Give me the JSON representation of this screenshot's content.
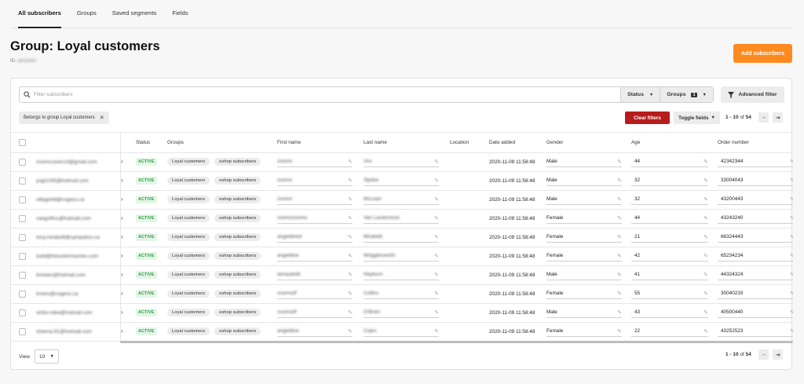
{
  "tabs": [
    {
      "label": "All subscribers",
      "active": true
    },
    {
      "label": "Groups",
      "active": false
    },
    {
      "label": "Saved segments",
      "active": false
    },
    {
      "label": "Fields",
      "active": false
    }
  ],
  "header": {
    "title": "Group: Loyal customers",
    "id_label": "ID:",
    "id_value": "aKOmIR",
    "add_button": "Add subscribers"
  },
  "filters": {
    "search_placeholder": "Filter subscribers",
    "status_label": "Status",
    "groups_label": "Groups",
    "groups_count": "1",
    "advanced_label": "Advanced filter",
    "chip_label": "Belongs to group Loyal customers",
    "clear_label": "Clear filters",
    "toggle_label": "Toggle fields"
  },
  "pager": {
    "range": "1 - 10",
    "of": "of",
    "total": "54"
  },
  "columns": {
    "status": "Status",
    "groups": "Groups",
    "first_name": "First name",
    "last_name": "Last name",
    "location": "Location",
    "date_added": "Date added",
    "gender": "Gender",
    "age": "Age",
    "order_number": "Order number"
  },
  "rows": [
    {
      "email": "zoomcruiser14@gmail.com",
      "status": "ACTIVE",
      "groups": [
        "Loyal customers",
        "eshop subscribers"
      ],
      "first": "zoomo",
      "last": "Vos",
      "date": "2020-11-09 11:58:48",
      "gender": "Male",
      "age": "44",
      "order": "42342344"
    },
    {
      "email": "yogi1335@hotmail.com",
      "status": "ACTIVE",
      "groups": [
        "Loyal customers",
        "eshop subscribers"
      ],
      "first": "zoomo",
      "last": "Sljoker",
      "date": "2020-11-09 11:58:48",
      "gender": "Male",
      "age": "32",
      "order": "33004043"
    },
    {
      "email": "villagehill@cogeco.ca",
      "status": "ACTIVE",
      "groups": [
        "Loyal customers",
        "eshop subscribers"
      ],
      "first": "zoomo",
      "last": "McLean",
      "date": "2020-11-09 11:58:48",
      "gender": "Male",
      "age": "32",
      "order": "43200443"
    },
    {
      "email": "vangolfinc@hotmail.com",
      "status": "ACTIVE",
      "groups": [
        "Loyal customers",
        "eshop subscribers"
      ],
      "first": "zoomozoomo",
      "last": "Van Landschoot",
      "date": "2020-11-09 11:58:48",
      "gender": "Female",
      "age": "44",
      "order": "43243240"
    },
    {
      "email": "tony.mirabelli@sympatico.ca",
      "status": "ACTIVE",
      "groups": [
        "Loyal customers",
        "eshop subscribers"
      ],
      "first": "angeldined",
      "last": "Mirabelli",
      "date": "2020-11-09 11:58:48",
      "gender": "Female",
      "age": "21",
      "order": "66324443"
    },
    {
      "email": "todd@theouterreaches.com",
      "status": "ACTIVE",
      "groups": [
        "Loyal customers",
        "eshop subscribers"
      ],
      "first": "angeldine",
      "last": "Wrigglesworth",
      "date": "2020-11-09 11:58:48",
      "gender": "Female",
      "age": "42",
      "order": "65234234"
    },
    {
      "email": "timwars@hotmail.com",
      "status": "ACTIVE",
      "groups": [
        "Loyal customers",
        "eshop subscribers"
      ],
      "first": "lamaodold",
      "last": "Hepburn",
      "date": "2020-11-09 11:58:48",
      "gender": "Male",
      "age": "41",
      "order": "44324324"
    },
    {
      "email": "tcreno@cogeco.ca",
      "status": "ACTIVE",
      "groups": [
        "Loyal customers",
        "eshop subscribers"
      ],
      "first": "zoomodf",
      "last": "Collins",
      "date": "2020-11-09 11:58:48",
      "gender": "Female",
      "age": "55",
      "order": "30040233"
    },
    {
      "email": "strike.mike@hotmail.com",
      "status": "ACTIVE",
      "groups": [
        "Loyal customers",
        "eshop subscribers"
      ],
      "first": "zoomodf",
      "last": "O'Brien",
      "date": "2020-11-09 11:58:48",
      "gender": "Male",
      "age": "43",
      "order": "40500440"
    },
    {
      "email": "sheena.91@hotmail.com",
      "status": "ACTIVE",
      "groups": [
        "Loyal customers",
        "eshop subscribers"
      ],
      "first": "angeldine",
      "last": "Cojes",
      "date": "2020-11-09 11:58:48",
      "gender": "Female",
      "age": "22",
      "order": "43252523"
    }
  ],
  "footer": {
    "view_label": "View",
    "view_value": "10"
  },
  "icons": {
    "search": "search-icon",
    "filter": "filter-icon",
    "close": "close-icon",
    "chevron": "chevron-right-icon",
    "pencil": "pencil-icon",
    "next": "arrow-right-icon",
    "last": "arrow-last-icon"
  },
  "colors": {
    "accent": "#ff8a1f",
    "danger": "#b71c1c",
    "active_bg": "#e3f6e6",
    "active_text": "#2e9b46"
  }
}
